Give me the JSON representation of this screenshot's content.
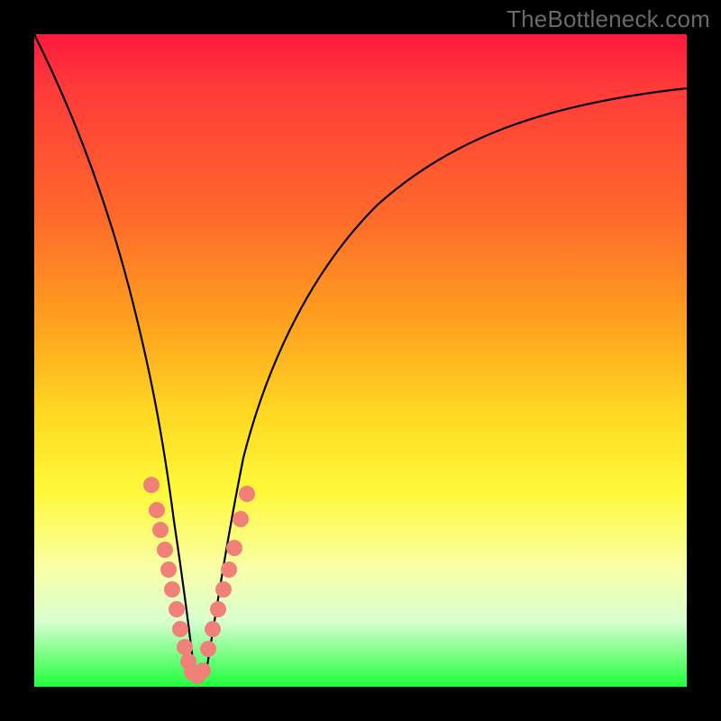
{
  "watermark": "TheBottleneck.com",
  "colors": {
    "page_bg": "#000000",
    "gradient_top": "#ff193e",
    "gradient_mid1": "#ff6a2a",
    "gradient_mid2": "#ffd823",
    "gradient_mid3": "#fff93a",
    "gradient_bottom": "#1eff3a",
    "curve": "#000000",
    "marker_fill": "#f08078",
    "marker_stroke": "#f08078",
    "watermark": "#6a6a6a"
  },
  "chart_data": {
    "type": "line",
    "title": "",
    "xlabel": "",
    "ylabel": "",
    "xlim": [
      0,
      100
    ],
    "ylim": [
      0,
      100
    ],
    "grid": false,
    "legend": false,
    "note": "Y is bottleneck/mismatch percentage (0 = bottom/green/optimal, 100 = top/red). X is a component-ratio axis with optimum near x≈24.",
    "series": [
      {
        "name": "bottleneck-curve",
        "x": [
          0,
          4,
          8,
          12,
          16,
          18,
          20,
          22,
          23,
          24,
          25,
          26,
          28,
          30,
          34,
          40,
          48,
          58,
          70,
          84,
          100
        ],
        "y": [
          100,
          88,
          74,
          58,
          41,
          31,
          21,
          11,
          6,
          2,
          2,
          5,
          12,
          18,
          30,
          42,
          55,
          66,
          76,
          84,
          90
        ]
      }
    ],
    "curve_minimum": {
      "x": 24.5,
      "y": 1
    },
    "markers": {
      "description": "Highlighted data points near the curve minimum and lower flanks (salmon beads).",
      "points": [
        {
          "x": 18.0,
          "y": 31
        },
        {
          "x": 18.8,
          "y": 27
        },
        {
          "x": 19.4,
          "y": 24
        },
        {
          "x": 20.0,
          "y": 21
        },
        {
          "x": 20.6,
          "y": 18
        },
        {
          "x": 21.2,
          "y": 15
        },
        {
          "x": 21.8,
          "y": 12
        },
        {
          "x": 22.4,
          "y": 9
        },
        {
          "x": 23.0,
          "y": 6
        },
        {
          "x": 23.6,
          "y": 4
        },
        {
          "x": 24.2,
          "y": 2
        },
        {
          "x": 25.0,
          "y": 2
        },
        {
          "x": 25.8,
          "y": 3
        },
        {
          "x": 26.6,
          "y": 6
        },
        {
          "x": 27.4,
          "y": 9
        },
        {
          "x": 28.2,
          "y": 12
        },
        {
          "x": 29.0,
          "y": 15
        },
        {
          "x": 29.8,
          "y": 18
        },
        {
          "x": 30.6,
          "y": 22
        },
        {
          "x": 31.6,
          "y": 26
        },
        {
          "x": 32.6,
          "y": 30
        }
      ]
    }
  }
}
